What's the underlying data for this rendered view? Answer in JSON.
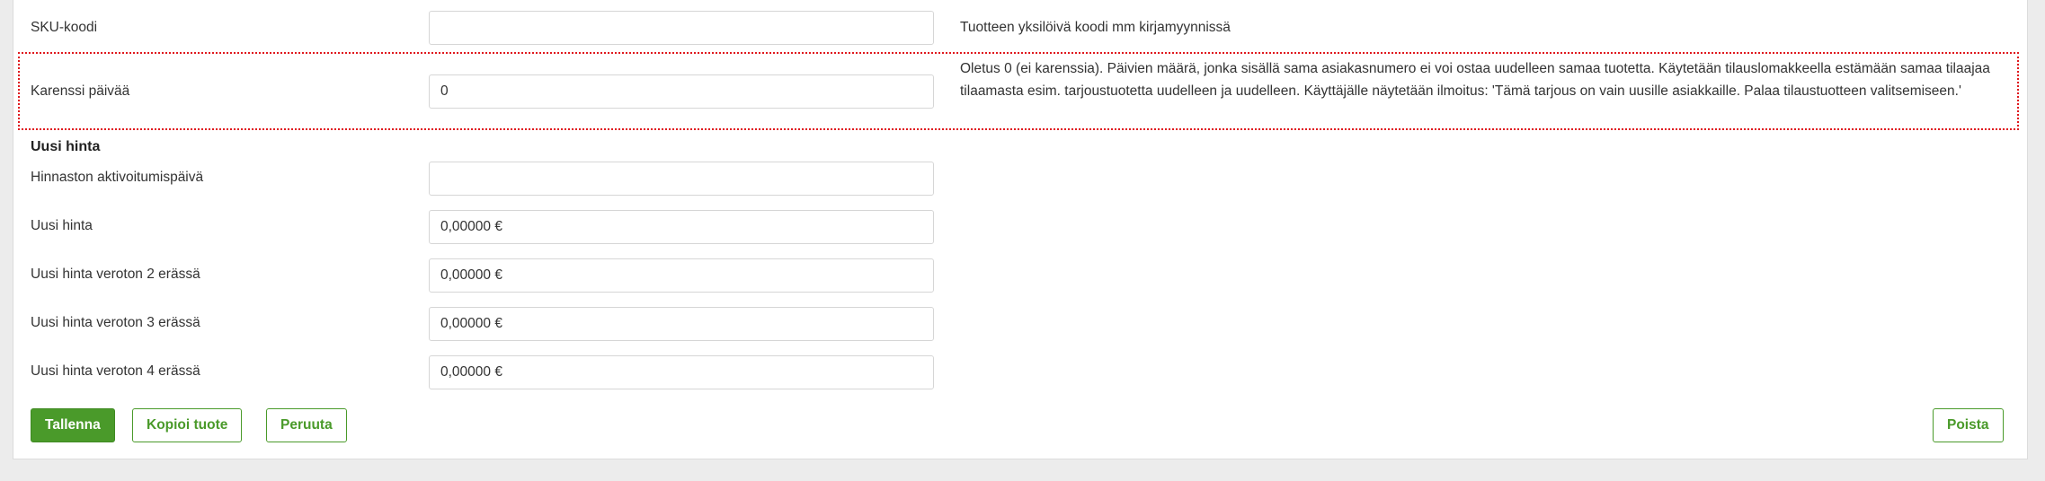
{
  "fields": {
    "sku": {
      "label": "SKU-koodi",
      "value": "",
      "help": "Tuotteen yksilöivä koodi mm kirjamyynnissä"
    },
    "karenssi": {
      "label": "Karenssi päivää",
      "value": "0",
      "help": "Oletus 0 (ei karenssia). Päivien määrä, jonka sisällä sama asiakasnumero ei voi ostaa uudelleen samaa tuotetta. Käytetään tilauslomakkeella estämään samaa tilaajaa tilaamasta esim. tarjoustuotetta uudelleen ja uudelleen. Käyttäjälle näytetään ilmoitus: 'Tämä tarjous on vain uusille asiakkaille. Palaa tilaustuotteen valitsemiseen.'"
    }
  },
  "new_price": {
    "section_title": "Uusi hinta",
    "activation_date": {
      "label": "Hinnaston aktivoitumispäivä",
      "value": ""
    },
    "price": {
      "label": "Uusi hinta",
      "value": "0,00000 €"
    },
    "price_2": {
      "label": "Uusi hinta veroton 2 erässä",
      "value": "0,00000 €"
    },
    "price_3": {
      "label": "Uusi hinta veroton 3 erässä",
      "value": "0,00000 €"
    },
    "price_4": {
      "label": "Uusi hinta veroton 4 erässä",
      "value": "0,00000 €"
    }
  },
  "actions": {
    "save": "Tallenna",
    "copy": "Kopioi tuote",
    "cancel": "Peruuta",
    "delete": "Poista"
  },
  "colors": {
    "accent": "#4a9a2a",
    "highlight_border": "#e0191e"
  }
}
